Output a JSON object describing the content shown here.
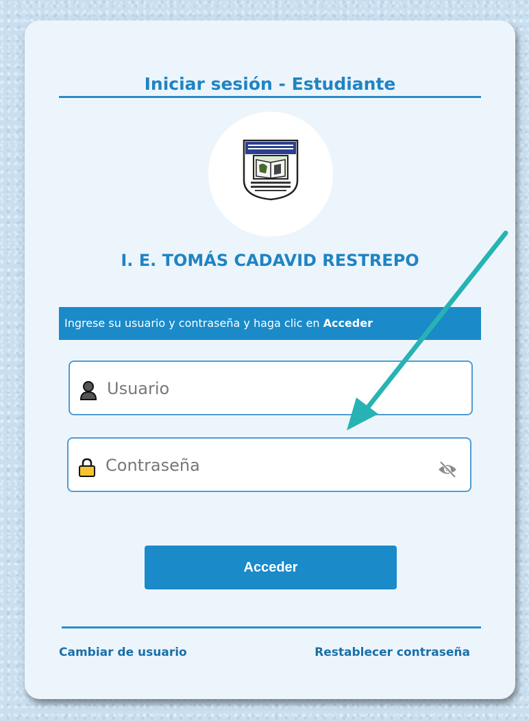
{
  "header": {
    "title": "Iniciar sesión - Estudiante"
  },
  "school": {
    "name": "I. E. TOMÁS CADAVID RESTREPO",
    "logo_icon": "school-crest-icon"
  },
  "instructions": {
    "text": "Ingrese su usuario y contraseña y haga clic en ",
    "emphasis": "Acceder"
  },
  "form": {
    "username": {
      "placeholder": "Usuario",
      "value": "",
      "icon": "user-icon"
    },
    "password": {
      "placeholder": "Contraseña",
      "value": "",
      "icon": "lock-icon",
      "toggle_icon": "eye-slash-icon"
    },
    "submit_label": "Acceder"
  },
  "links": {
    "change_user": "Cambiar de usuario",
    "reset_password": "Restablecer contraseña"
  },
  "colors": {
    "accent": "#1a8ac9",
    "title": "#1f84c3",
    "card_bg": "#edf5fc",
    "annotation_arrow": "#27b3b3"
  }
}
